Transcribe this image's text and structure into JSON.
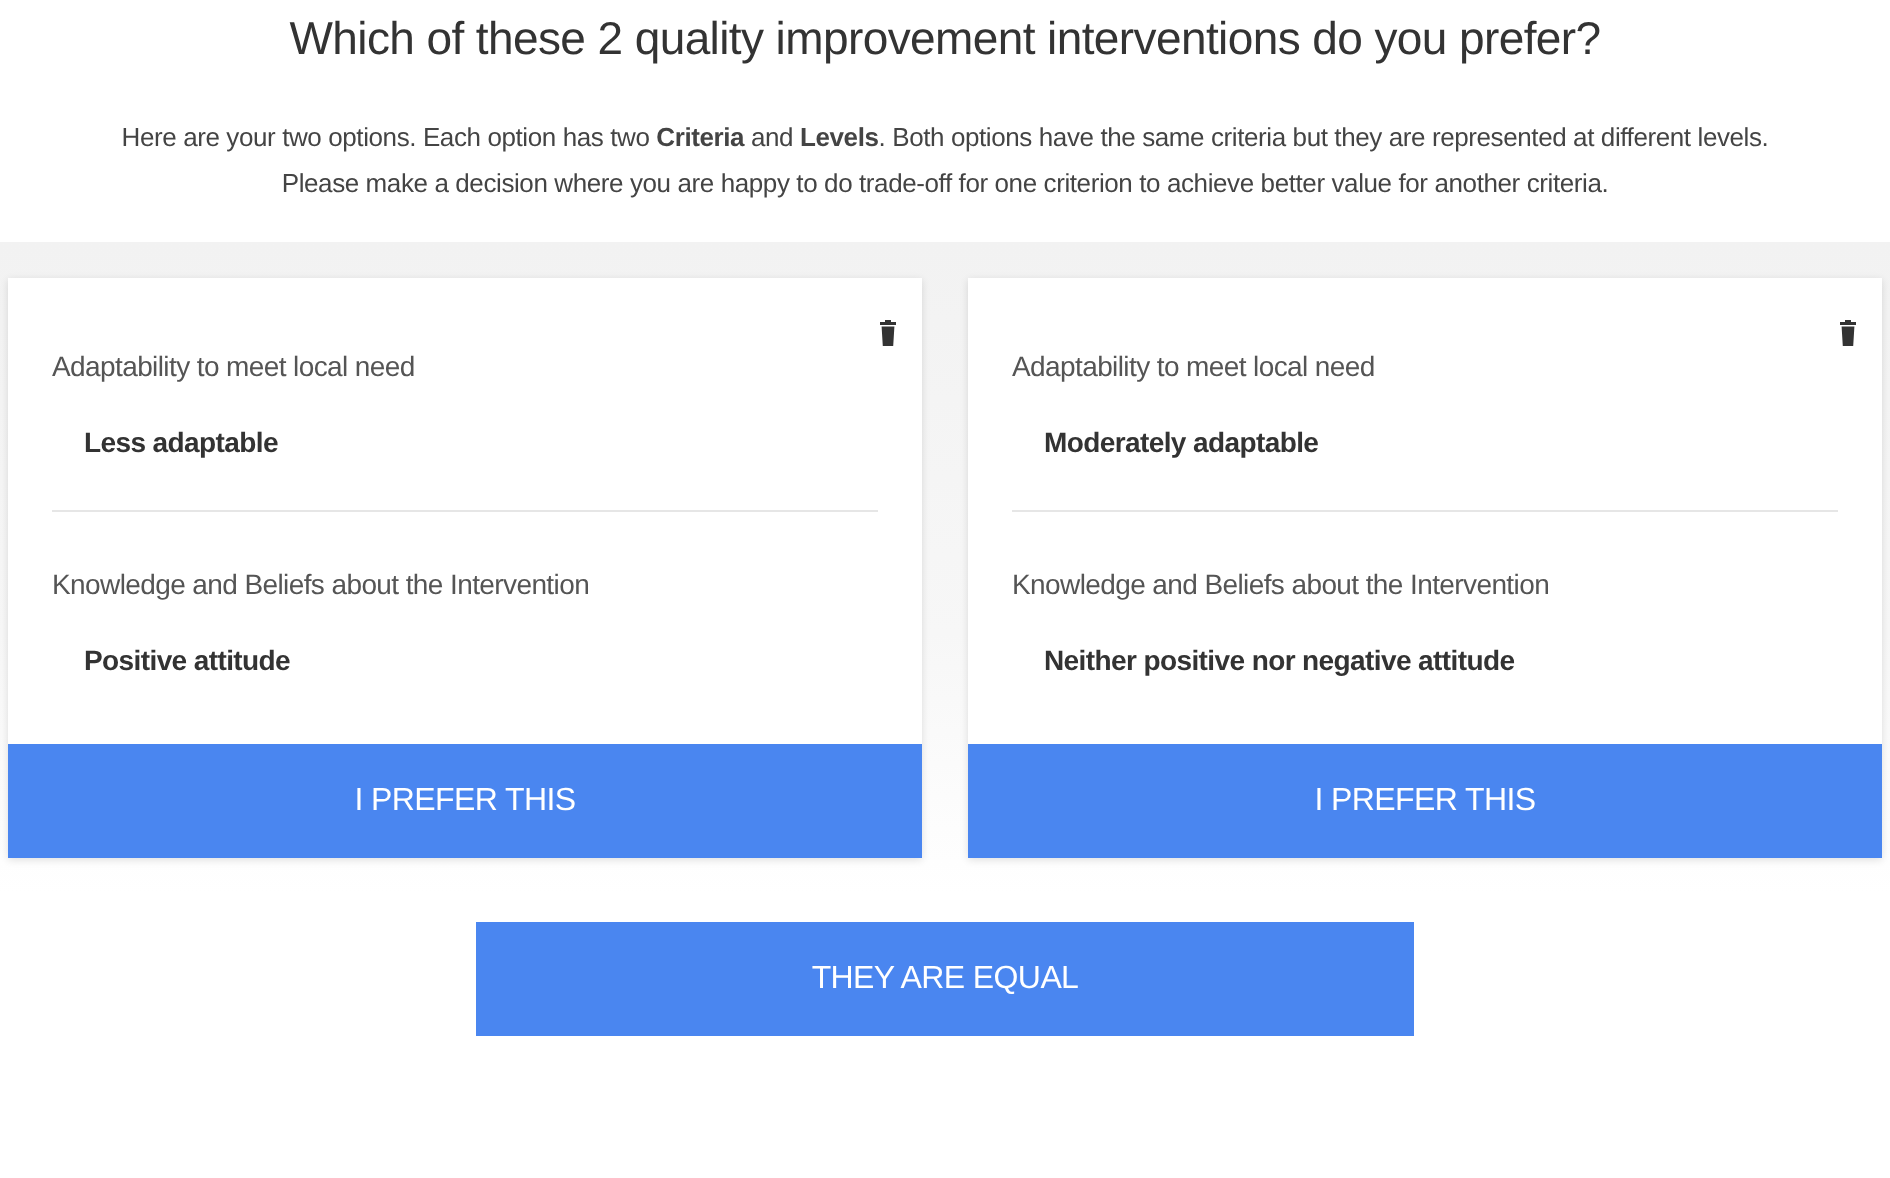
{
  "title": "Which of these 2 quality improvement interventions do you prefer?",
  "intro": [
    "Here are your two options. Each option has two **Criteria** and **Levels**. Both options have the same criteria but they are represented at different levels.",
    "Please make a decision where you are happy to do trade-off for one criterion to achieve better value for another criteria."
  ],
  "options": [
    {
      "criteria": [
        {
          "name": "Adaptability to meet local need",
          "level": "Less adaptable"
        },
        {
          "name": "Knowledge and Beliefs about the Intervention",
          "level": "Positive attitude"
        }
      ],
      "button": "I PREFER THIS"
    },
    {
      "criteria": [
        {
          "name": "Adaptability to meet local need",
          "level": "Moderately adaptable"
        },
        {
          "name": "Knowledge and Beliefs about the Intervention",
          "level": "Neither positive nor negative attitude"
        }
      ],
      "button": "I PREFER THIS"
    }
  ],
  "equal_button": "THEY ARE EQUAL"
}
